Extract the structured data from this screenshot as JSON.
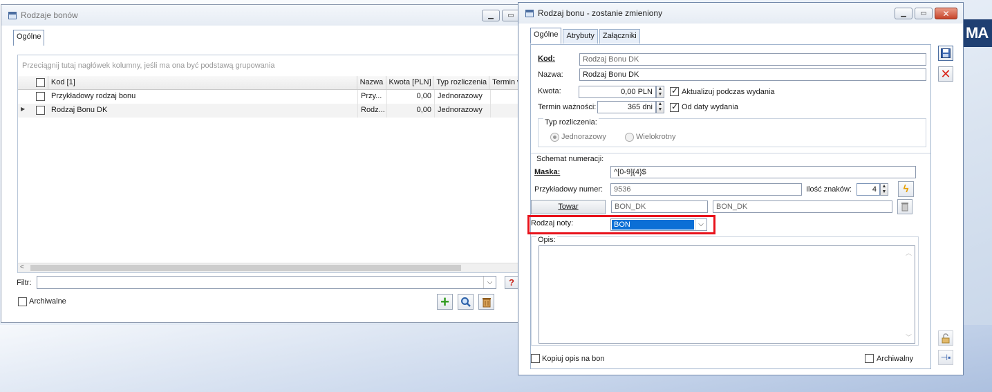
{
  "background": {
    "logo_text": "MA"
  },
  "list_window": {
    "title": "Rodzaje bonów",
    "tabs": [
      "Ogólne"
    ],
    "group_hint": "Przeciągnij tutaj nagłówek kolumny, jeśli ma ona być podstawą grupowania",
    "columns": [
      "Kod [1]",
      "Nazwa",
      "Kwota [PLN]",
      "Typ rozliczenia",
      "Termin w"
    ],
    "rows": [
      {
        "kod": "Przykładowy rodzaj bonu",
        "nazwa": "Przy...",
        "kwota": "0,00",
        "typ": "Jednorazowy"
      },
      {
        "kod": "Rodzaj Bonu DK",
        "nazwa": "Rodz...",
        "kwota": "0,00",
        "typ": "Jednorazowy"
      }
    ],
    "filter_label": "Filtr:",
    "filter_value": "",
    "archive_label": "Archiwalne"
  },
  "detail_window": {
    "title": "Rodzaj bonu - zostanie zmieniony",
    "tabs": [
      "Ogólne",
      "Atrybuty",
      "Załączniki"
    ],
    "kod_label": "Kod:",
    "kod_value": "Rodzaj Bonu DK",
    "nazwa_label": "Nazwa:",
    "nazwa_value": "Rodzaj Bonu DK",
    "kwota_label": "Kwota:",
    "kwota_value": "0,00 PLN",
    "aktualizuj_label": "Aktualizuj podczas wydania",
    "aktualizuj_checked": true,
    "termin_label": "Termin ważności:",
    "termin_value": "365 dni",
    "od_daty_label": "Od daty wydania",
    "od_daty_checked": true,
    "typ_group_label": "Typ rozliczenia:",
    "radio_jednorazowy": "Jednorazowy",
    "radio_wielokrotny": "Wielokrotny",
    "schemat_group_label": "Schemat numeracji:",
    "maska_label": "Maska:",
    "maska_value": "^[0-9]{4}$",
    "przykladowy_label": "Przykładowy numer:",
    "przykladowy_value": "9536",
    "ilosc_label": "Ilość znaków:",
    "ilosc_value": "4",
    "towar_button": "Towar",
    "towar_code": "BON_DK",
    "towar_name": "BON_DK",
    "rodzaj_noty_label": "Rodzaj noty:",
    "rodzaj_noty_value": "BON",
    "opis_label": "Opis:",
    "opis_value": "",
    "kopiuj_label": "Kopiuj opis na bon",
    "archiwalny_label": "Archiwalny",
    "highlight_color": "#e8121b",
    "select_color": "#0b6fd6"
  }
}
